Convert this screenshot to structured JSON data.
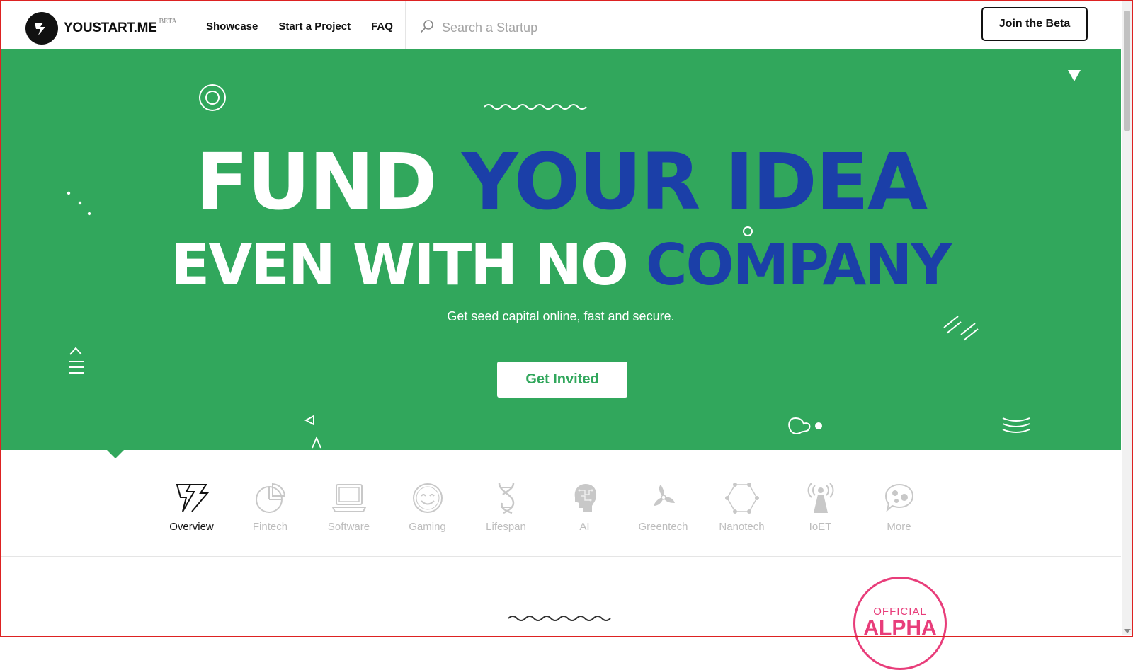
{
  "brand": {
    "name": "YOUSTART.ME",
    "badge": "BETA"
  },
  "nav": [
    {
      "label": "Showcase"
    },
    {
      "label": "Start a Project"
    },
    {
      "label": "FAQ"
    }
  ],
  "search": {
    "placeholder": "Search a Startup",
    "icon": "search-icon"
  },
  "join_button": "Join the Beta",
  "hero": {
    "line1_white": "FUND",
    "line1_blue": "YOUR IDEA",
    "line2_white": "EVEN WITH NO",
    "line2_blue": "COMPANY",
    "subtitle": "Get seed capital online, fast and secure.",
    "cta": "Get Invited"
  },
  "categories": [
    {
      "label": "Overview",
      "icon": "bolt-icon",
      "active": true
    },
    {
      "label": "Fintech",
      "icon": "pie-chart-icon"
    },
    {
      "label": "Software",
      "icon": "laptop-icon"
    },
    {
      "label": "Gaming",
      "icon": "smiley-icon"
    },
    {
      "label": "Lifespan",
      "icon": "dna-icon"
    },
    {
      "label": "AI",
      "icon": "brain-head-icon"
    },
    {
      "label": "Greentech",
      "icon": "windmill-icon"
    },
    {
      "label": "Nanotech",
      "icon": "hexagon-network-icon"
    },
    {
      "label": "IoET",
      "icon": "antenna-icon"
    },
    {
      "label": "More",
      "icon": "chat-bubble-icon"
    }
  ],
  "badge": {
    "top": "OFFICIAL",
    "main": "ALPHA"
  },
  "colors": {
    "hero_green": "#31a75c",
    "headline_blue": "#1b3fa8",
    "alpha_pink": "#e83d7a"
  }
}
